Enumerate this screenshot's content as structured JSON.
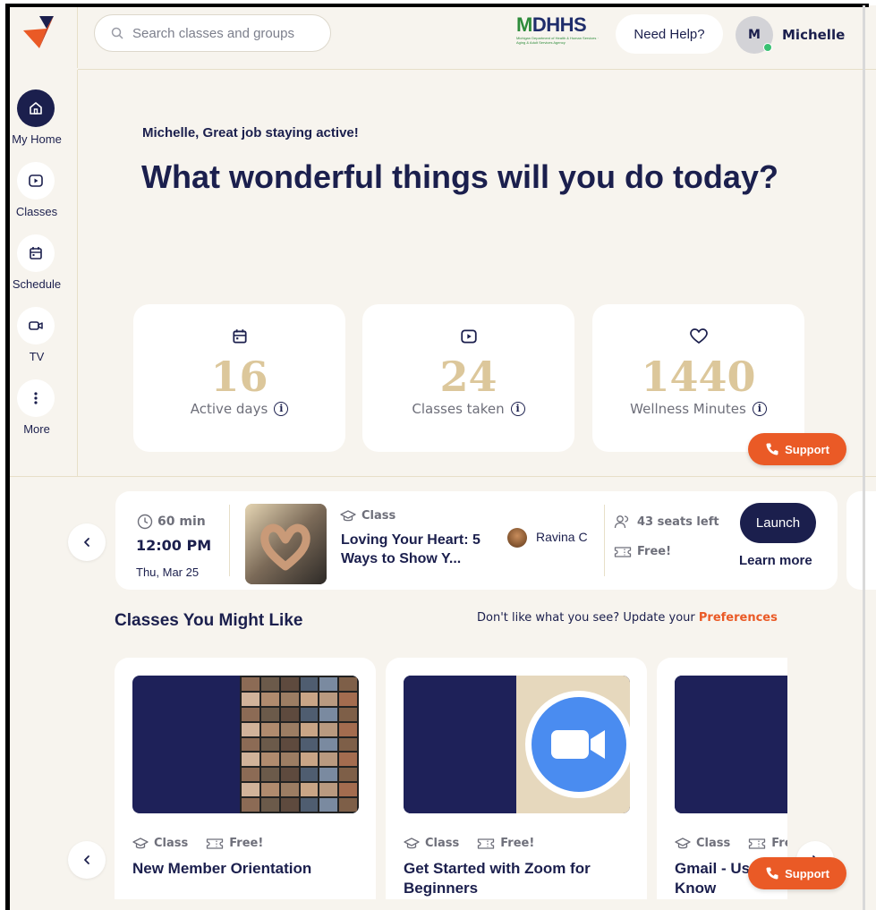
{
  "brand": {
    "logo_name": "app-logo",
    "accent": "#ea5a26",
    "navy": "#1b1f4d"
  },
  "search": {
    "placeholder": "Search classes and groups"
  },
  "partner": {
    "title_m": "M",
    "title_rest": "DHHS",
    "subtitle": "Michigan Department of Health & Human Services · Aging & Adult Services Agency"
  },
  "header": {
    "help_label": "Need Help?",
    "avatar_initial": "M",
    "user_name": "Michelle"
  },
  "sidebar": {
    "items": [
      {
        "label": "My Home",
        "icon": "home-icon",
        "active": true
      },
      {
        "label": "Classes",
        "icon": "play-icon",
        "active": false
      },
      {
        "label": "Schedule",
        "icon": "calendar-icon",
        "active": false
      },
      {
        "label": "TV",
        "icon": "video-camera-icon",
        "active": false
      },
      {
        "label": "More",
        "icon": "more-vertical-icon",
        "active": false
      }
    ]
  },
  "hero": {
    "greeting": "Michelle, Great job staying active!",
    "headline": "What wonderful things will you do today?"
  },
  "stats": [
    {
      "value": "16",
      "label": "Active days",
      "icon": "calendar-icon"
    },
    {
      "value": "24",
      "label": "Classes taken",
      "icon": "play-icon"
    },
    {
      "value": "1440",
      "label": "Wellness Minutes",
      "icon": "heart-icon"
    }
  ],
  "support": {
    "label": "Support"
  },
  "upcoming": {
    "duration": "60 min",
    "time": "12:00 PM",
    "date": "Thu, Mar 25",
    "type": "Class",
    "title": "Loving Your Heart: 5 Ways to Show Y...",
    "instructor": "Ravina C",
    "seats": "43 seats left",
    "price": "Free!",
    "launch_label": "Launch",
    "learn_more_label": "Learn more"
  },
  "recommended": {
    "title": "Classes You Might Like",
    "pref_text": "Don't like what you see? Update your ",
    "pref_link": "Preferences",
    "cards": [
      {
        "type": "Class",
        "price": "Free!",
        "title": "New Member Orientation"
      },
      {
        "type": "Class",
        "price": "Free!",
        "title": "Get Started with Zoom for Beginners"
      },
      {
        "type": "Class",
        "price": "Free!",
        "title": "Gmail - Useful Tips You May Not Know"
      }
    ]
  }
}
